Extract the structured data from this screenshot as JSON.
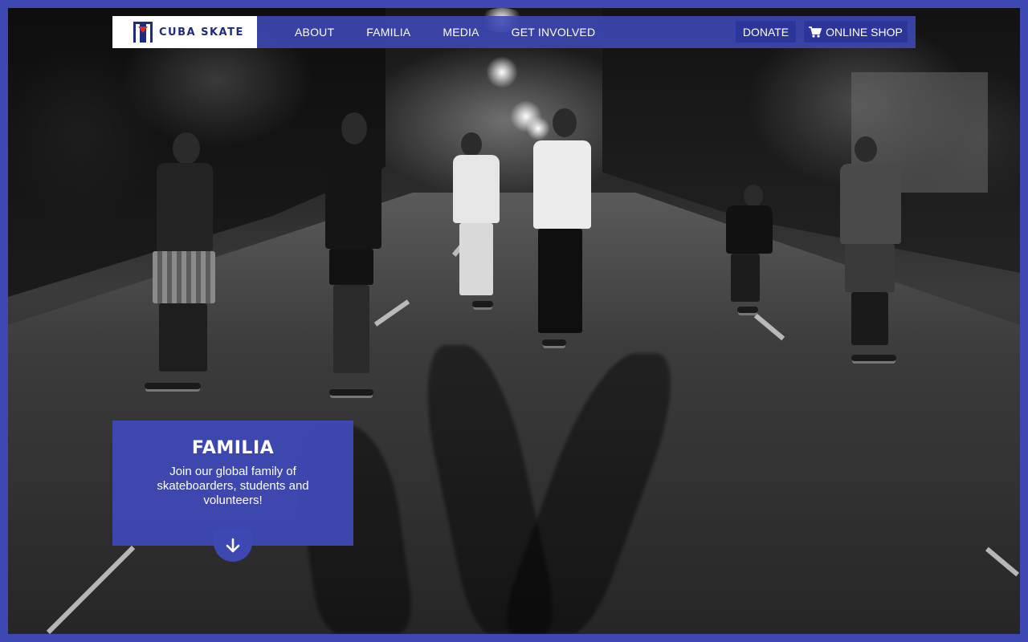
{
  "brand": {
    "name": "CUBA SKATE"
  },
  "nav": {
    "items": [
      {
        "label": "ABOUT"
      },
      {
        "label": "FAMILIA"
      },
      {
        "label": "MEDIA"
      },
      {
        "label": "GET INVOLVED"
      }
    ],
    "donate_label": "DONATE",
    "shop_label": "ONLINE SHOP",
    "shop_icon": "cart-icon"
  },
  "callout": {
    "title": "FAMILIA",
    "text": "Join our global family of skateboarders, students and volunteers!",
    "arrow_icon": "arrow-down-icon"
  },
  "colors": {
    "accent": "#3d48b3",
    "button": "#2c359a",
    "logo_text": "#1f2b7d"
  }
}
